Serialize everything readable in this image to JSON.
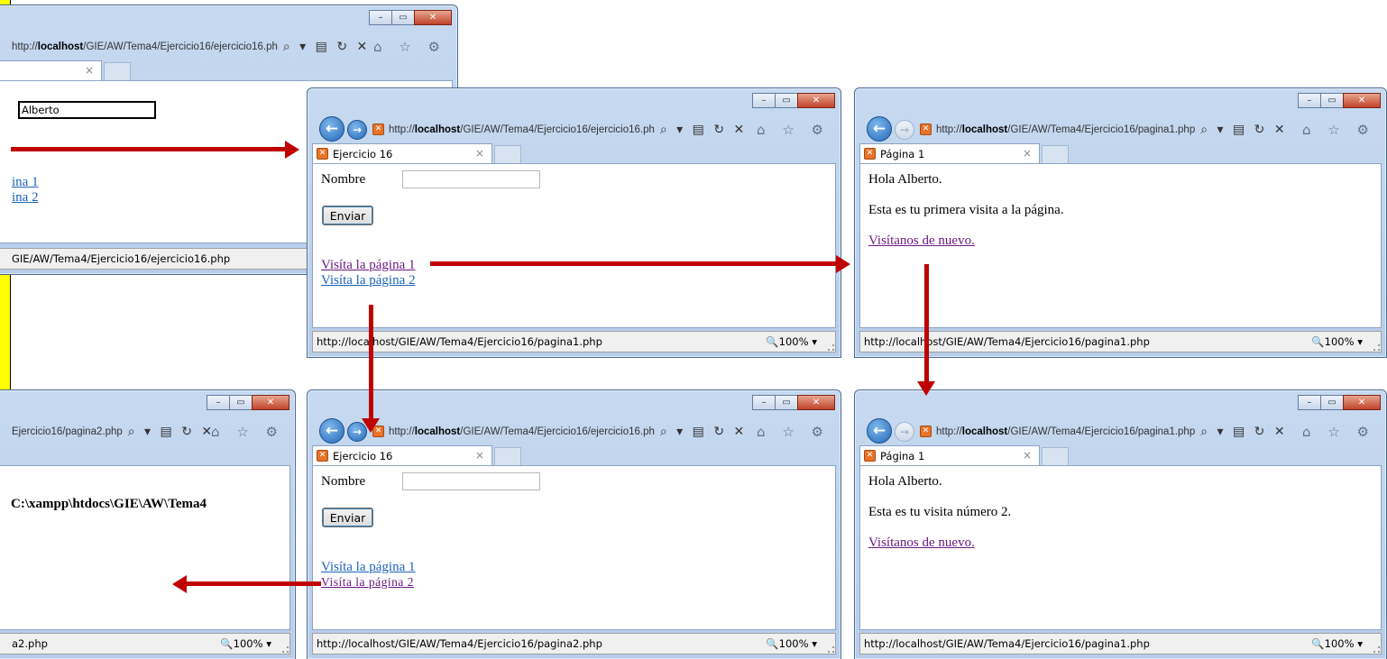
{
  "windows": [
    {
      "id": "w1",
      "url_start": "http://",
      "url_host": "localhost",
      "url_end": "/GIE/AW/Tema4/Ejercicio16/ejercicio16.ph",
      "tab_title": "",
      "input_value": "Alberto",
      "link1": "ina 1",
      "link2": "ina 2",
      "status": "GIE/AW/Tema4/Ejercicio16/ejercicio16.php"
    },
    {
      "id": "w2",
      "url_start": "http://",
      "url_host": "localhost",
      "url_end": "/GIE/AW/Tema4/Ejercicio16/ejercicio16.ph",
      "tab_title": "Ejercicio 16",
      "label": "Nombre",
      "button": "Enviar",
      "link1": "Visíta la página 1",
      "link2": "Visíta la página 2",
      "status": "http://localhost/GIE/AW/Tema4/Ejercicio16/pagina1.php",
      "zoom": "100%"
    },
    {
      "id": "w3",
      "url_start": "http://",
      "url_host": "localhost",
      "url_end": "/GIE/AW/Tema4/Ejercicio16/pagina1.php",
      "tab_title": "Página 1",
      "line1": "Hola Alberto.",
      "line2": "Esta es tu primera visita a la página.",
      "link": "Visítanos de nuevo.",
      "status": "http://localhost/GIE/AW/Tema4/Ejercicio16/pagina1.php",
      "zoom": "100%"
    },
    {
      "id": "w4",
      "url_text": "Ejercicio16/pagina2.php",
      "heading": "C:\\xampp\\htdocs\\GIE\\AW\\Tema4",
      "status": "a2.php",
      "zoom": "100%"
    },
    {
      "id": "w5",
      "url_start": "http://",
      "url_host": "localhost",
      "url_end": "/GIE/AW/Tema4/Ejercicio16/ejercicio16.ph",
      "tab_title": "Ejercicio 16",
      "label": "Nombre",
      "button": "Enviar",
      "link1": "Visíta la página 1",
      "link2": "Visíta la página 2",
      "status": "http://localhost/GIE/AW/Tema4/Ejercicio16/pagina2.php",
      "zoom": "100%"
    },
    {
      "id": "w6",
      "url_start": "http://",
      "url_host": "localhost",
      "url_end": "/GIE/AW/Tema4/Ejercicio16/pagina1.php",
      "tab_title": "Página 1",
      "line1": "Hola Alberto.",
      "line2": "Esta es tu visita número 2.",
      "link": "Visítanos de nuevo.",
      "status": "http://localhost/GIE/AW/Tema4/Ejercicio16/pagina1.php",
      "zoom": "100%"
    }
  ],
  "chrome": {
    "minimize": "–",
    "maximize": "▭",
    "close": "✕",
    "back": "←",
    "forward": "→",
    "favicon": "✕",
    "tab_close": "×",
    "tools": "⌕ ▾ ▤ ↻ ✕",
    "right_tools": "⌂ ☆ ⚙",
    "zoom_icon": "🔍",
    "zoom_drop": "▾"
  },
  "colors": {
    "arrow": "#c00000",
    "link": "#1b62b9",
    "visited": "#6a1a83",
    "highlight": "#ffff00"
  }
}
